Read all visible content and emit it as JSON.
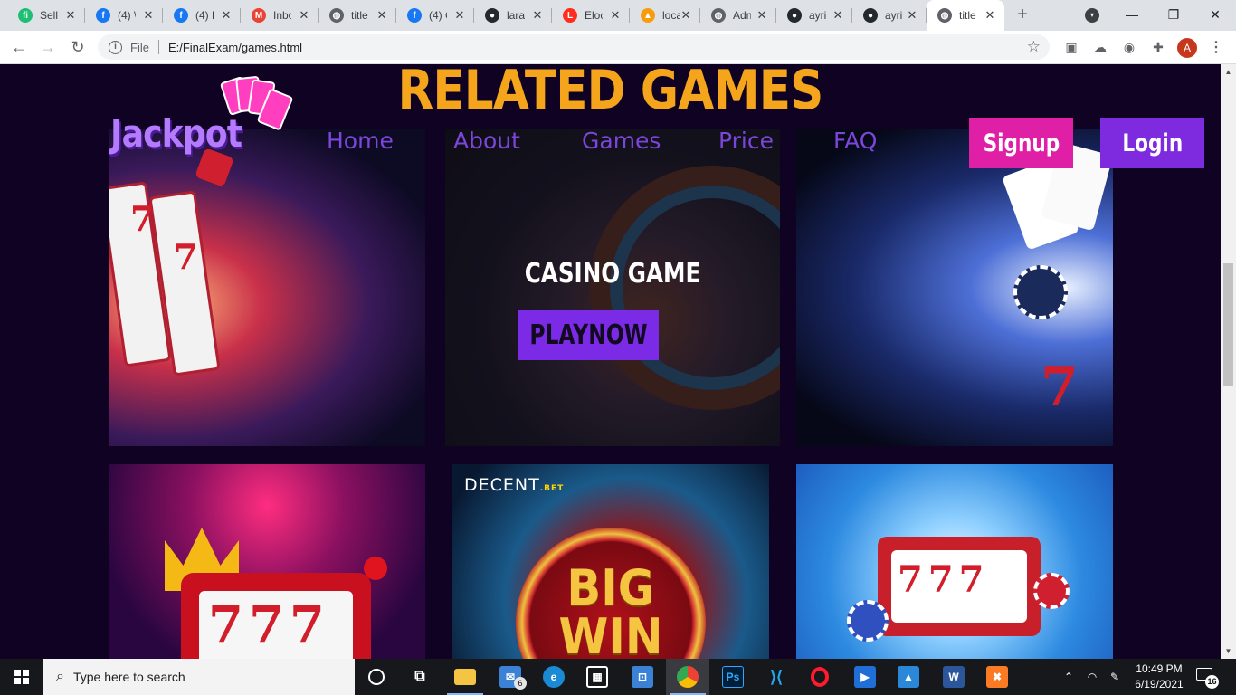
{
  "browser": {
    "tabs": [
      {
        "label": "Sell",
        "icon": "fiverr-icon",
        "color": "#1dbf73"
      },
      {
        "label": "(4) \\",
        "icon": "facebook-icon",
        "color": "#1877f2"
      },
      {
        "label": "(4) F",
        "icon": "facebook-icon",
        "color": "#1877f2"
      },
      {
        "label": "Inbo",
        "icon": "gmail-icon",
        "color": "#ea4335"
      },
      {
        "label": "title",
        "icon": "globe-icon",
        "color": "#5f6368"
      },
      {
        "label": "(4) C",
        "icon": "facebook-icon",
        "color": "#1877f2"
      },
      {
        "label": "lara",
        "icon": "github-icon",
        "color": "#24292e"
      },
      {
        "label": "Eloc",
        "icon": "laravel-icon",
        "color": "#ff2d20"
      },
      {
        "label": "loca",
        "icon": "phpmyadmin-icon",
        "color": "#f89c0e"
      },
      {
        "label": "Adn",
        "icon": "globe-icon",
        "color": "#5f6368"
      },
      {
        "label": "ayri",
        "icon": "github-icon",
        "color": "#24292e"
      },
      {
        "label": "ayri",
        "icon": "github-icon",
        "color": "#24292e"
      },
      {
        "label": "title",
        "icon": "globe-icon",
        "color": "#5f6368",
        "active": true
      }
    ],
    "address": {
      "scheme_label": "File",
      "url": "E:/FinalExam/games.html"
    },
    "profile_initial": "A"
  },
  "site": {
    "logo": "Jackpot",
    "nav": [
      {
        "label": "Home"
      },
      {
        "label": "About"
      },
      {
        "label": "Games"
      },
      {
        "label": "Price"
      },
      {
        "label": "FAQ"
      }
    ],
    "signup_label": "Signup",
    "login_label": "Login",
    "section_title": "RELATED GAMES",
    "featured_card": {
      "title": "CASINO GAME",
      "button": "PLAYNOW"
    },
    "card_texts": {
      "decent_brand": "DECENT",
      "decent_suffix": ".BET",
      "big_win_line1": "BIG",
      "big_win_line2": "WIN"
    }
  },
  "taskbar": {
    "search_placeholder": "Type here to search",
    "mail_badge": "6",
    "time": "10:49 PM",
    "date": "6/19/2021",
    "notification_count": "16"
  },
  "colors": {
    "page_bg": "#0f0222",
    "title_accent": "#f4a51c",
    "nav_purple": "#7b46d9",
    "signup_pink": "#df1fa6",
    "login_purple": "#7e2be0"
  }
}
